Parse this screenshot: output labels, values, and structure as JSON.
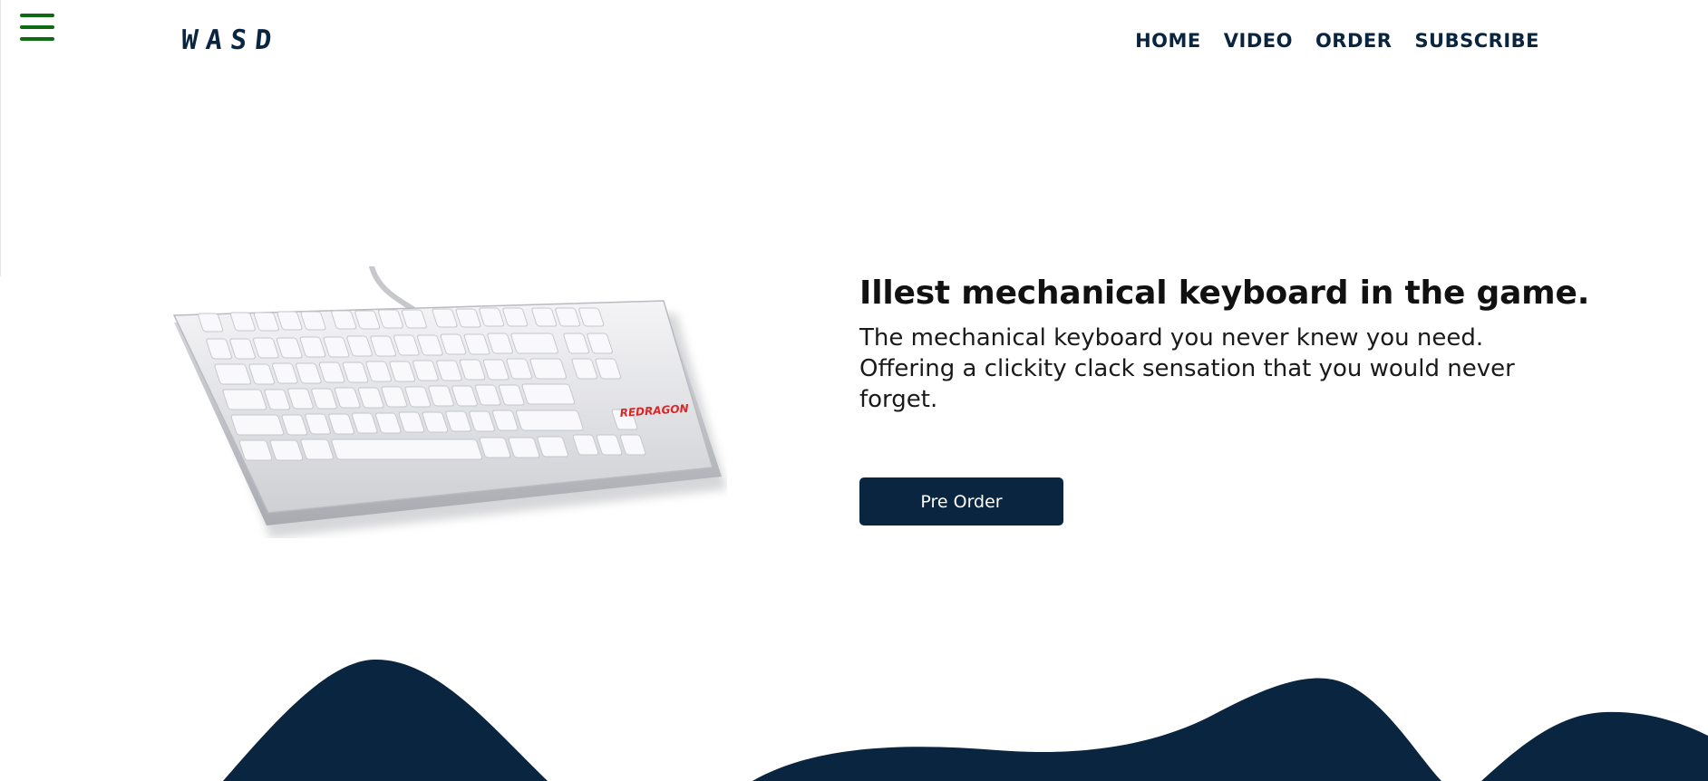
{
  "header": {
    "menu_icon": "hamburger-menu-icon",
    "logo": "WASD",
    "nav": [
      "HOME",
      "VIDEO",
      "ORDER",
      "SUBSCRIBE"
    ]
  },
  "hero": {
    "image": "white-mechanical-keyboard",
    "brand_on_keyboard": "REDRAGON",
    "title": "Illest mechanical keyboard in the game.",
    "description": "The mechanical keyboard you never knew you need. Offering a clickity clack sensation that you would never forget.",
    "cta_label": "Pre Order"
  },
  "colors": {
    "navy": "#0a2540",
    "menu_green": "#0f6b12",
    "accent_red": "#d62828",
    "background": "#ffffff"
  }
}
